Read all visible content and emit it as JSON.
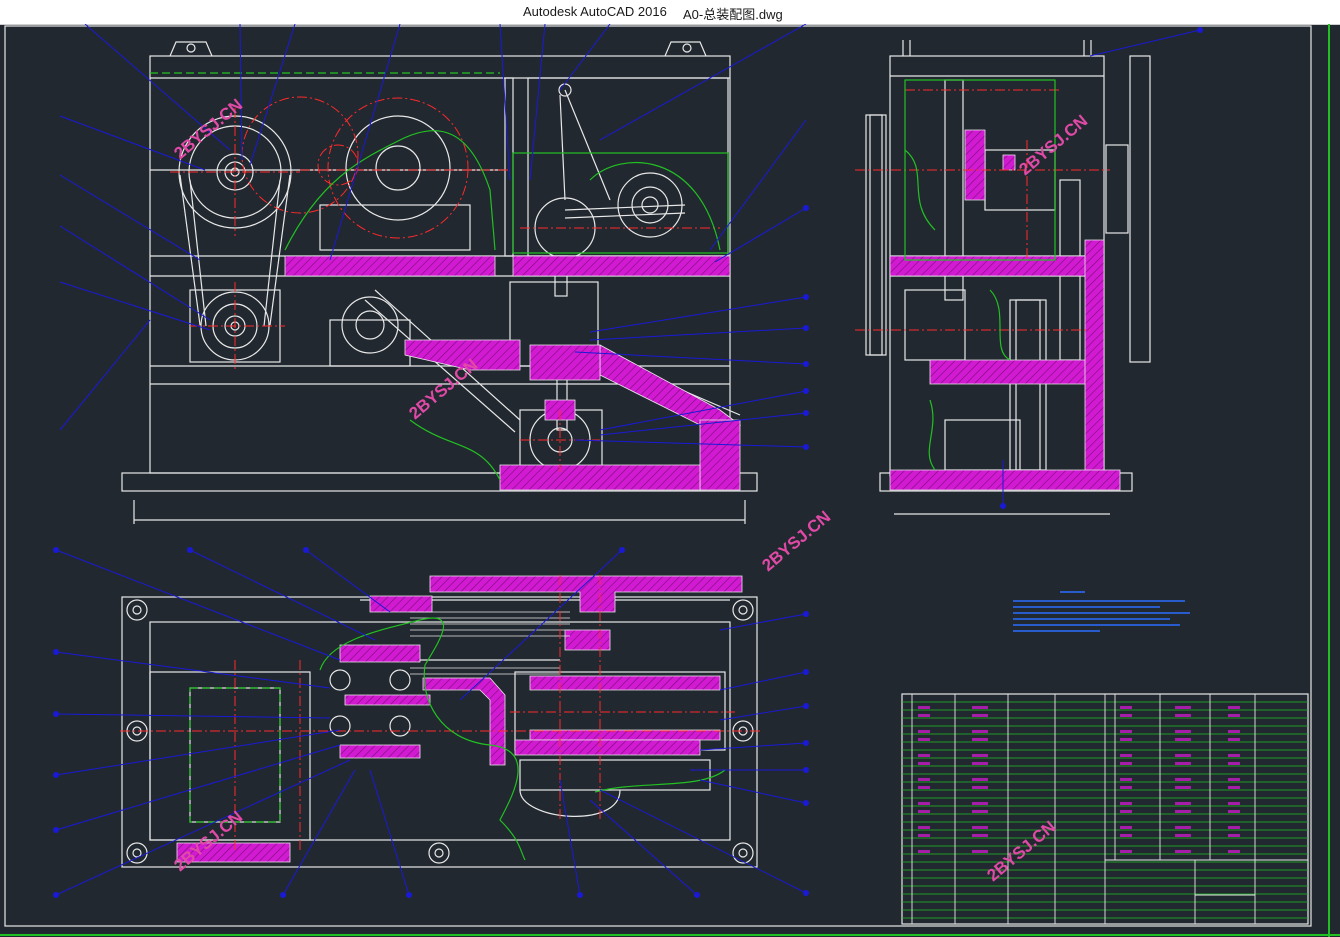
{
  "window": {
    "app_name": "Autodesk AutoCAD 2016",
    "file_name": "A0-总装配图.dwg"
  },
  "colors": {
    "background": "#212830",
    "outline": "#e8e8e8",
    "centerline": "#ff2a2a",
    "leader": "#1a1ad6",
    "hidden": "#22c022",
    "hatch": "#d11ad1",
    "watermark": "#e04aa6",
    "note_text": "#2a6cff"
  },
  "watermark": {
    "text": "2BYSJ.CN"
  }
}
